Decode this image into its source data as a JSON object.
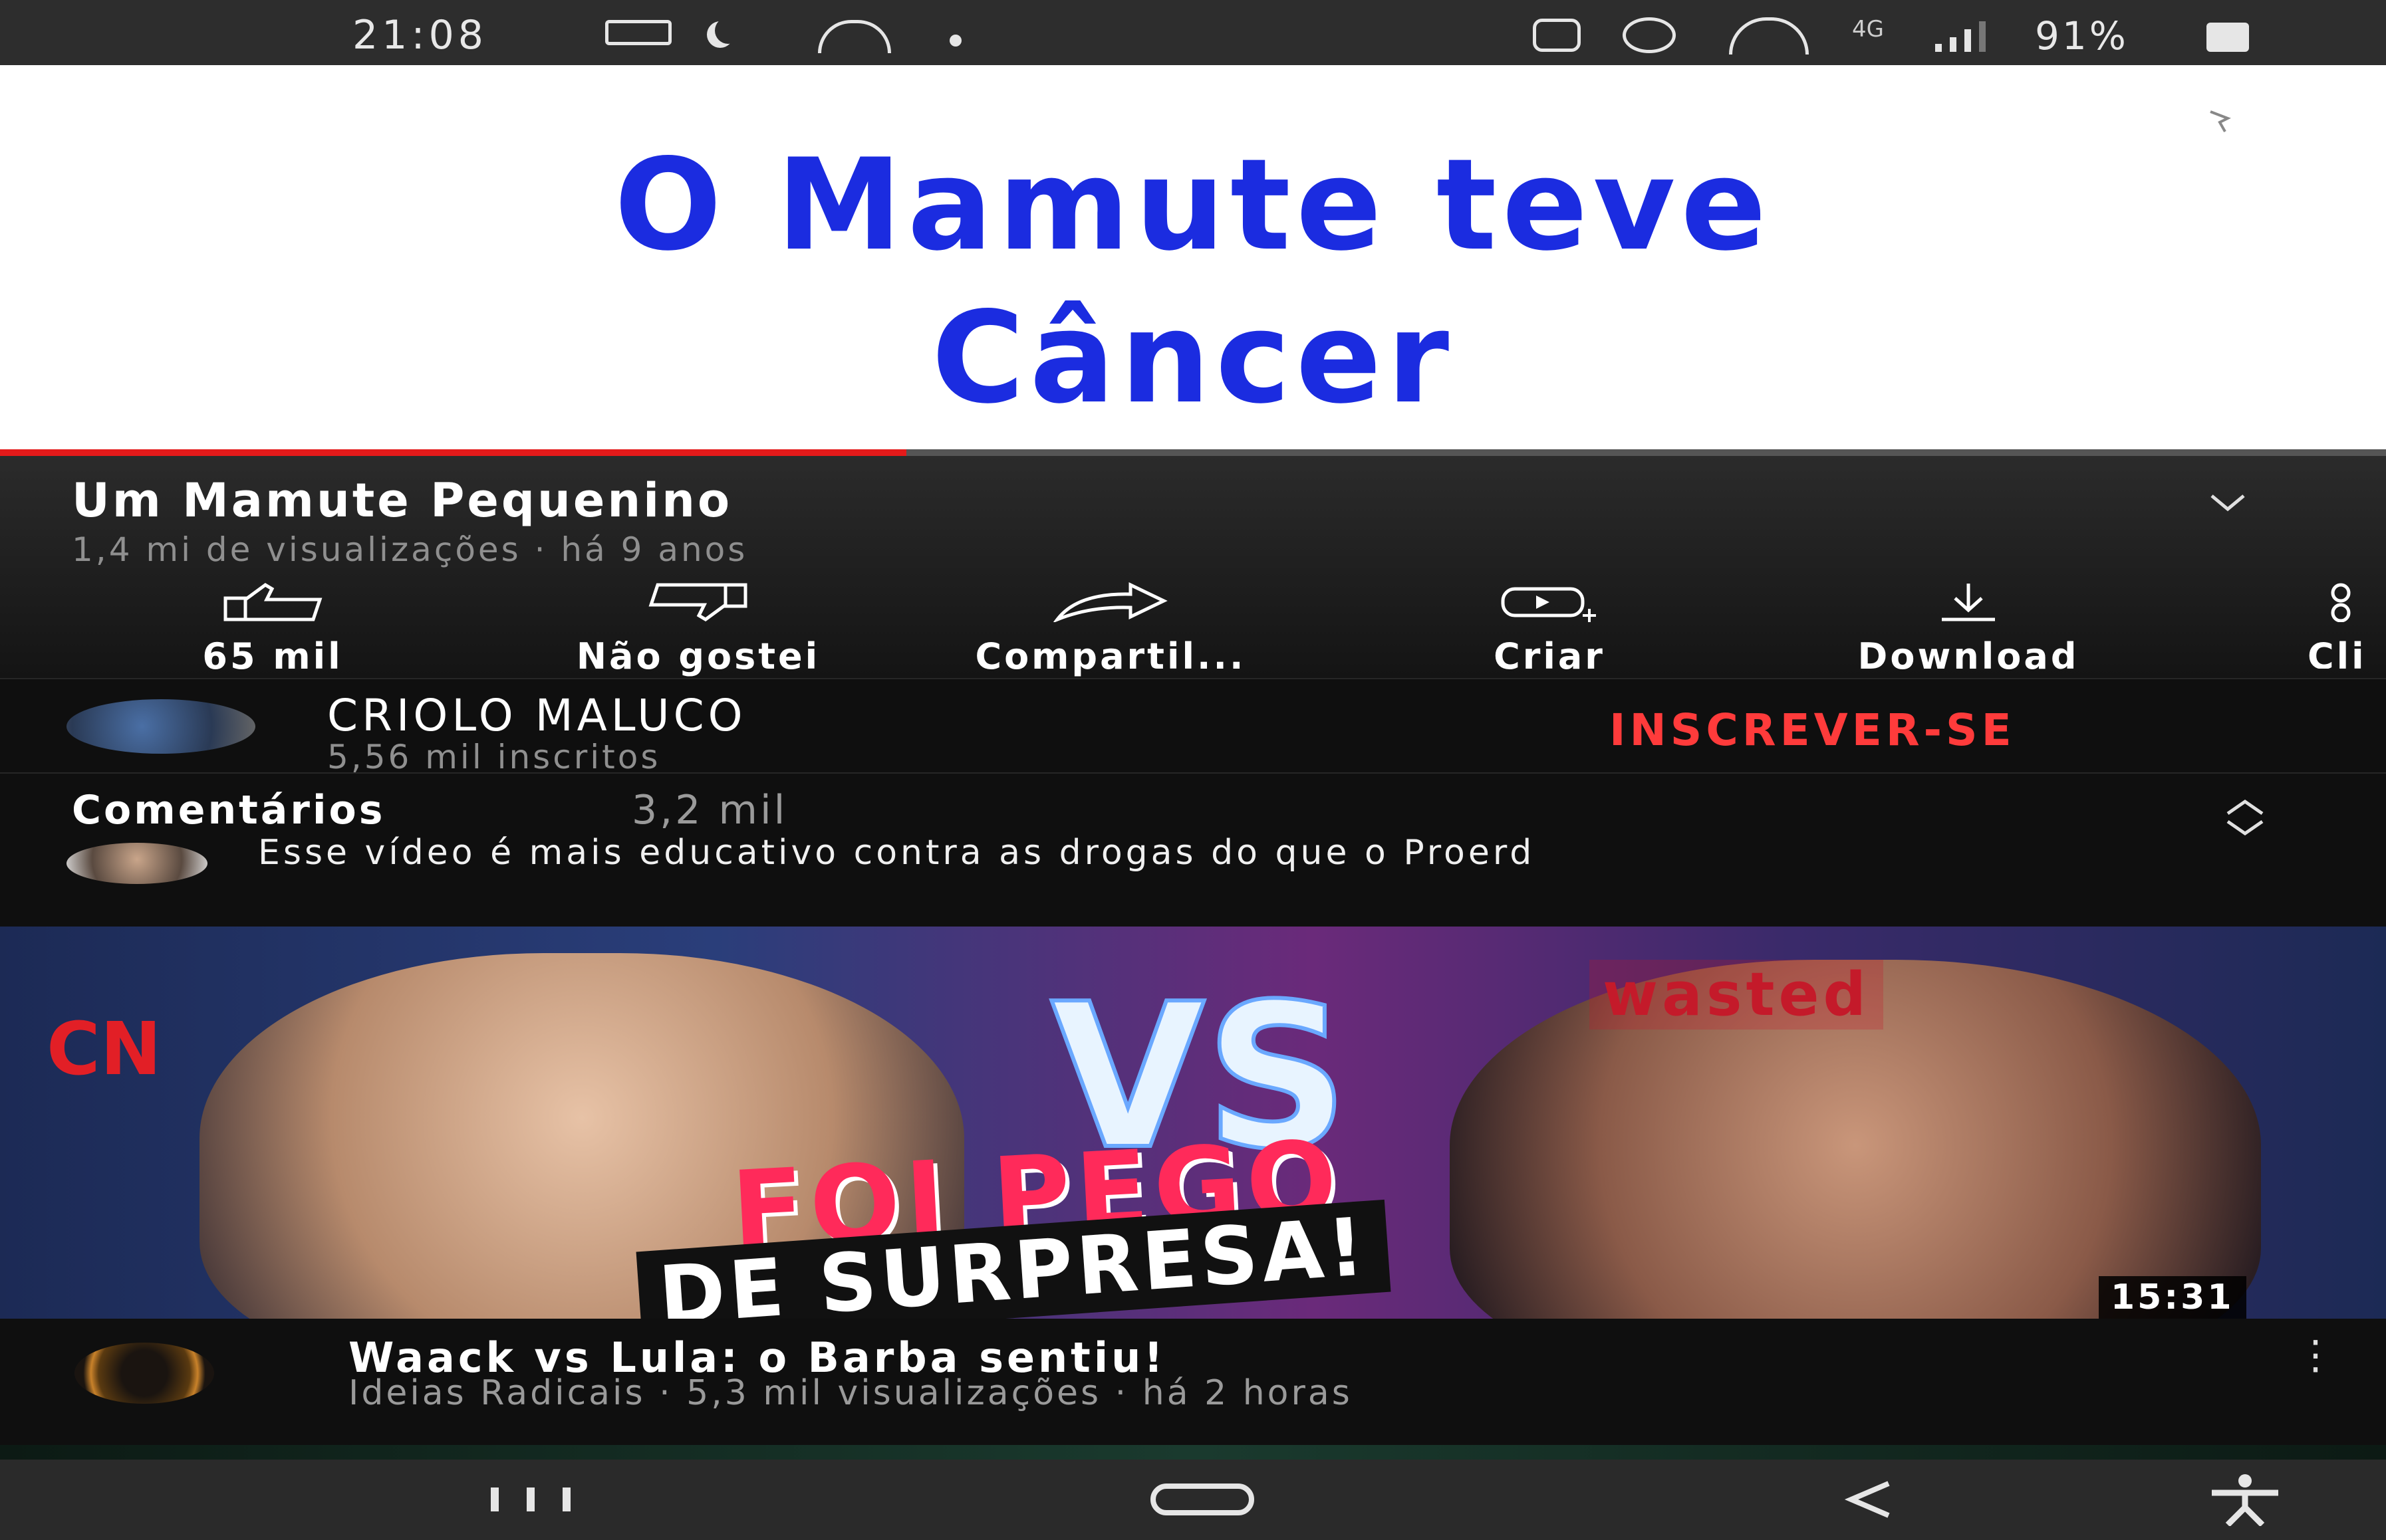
{
  "status_bar": {
    "time": "21:08",
    "network": "4G",
    "battery": "91%",
    "icons": [
      "gallery-icon",
      "moon-icon",
      "hotspot-icon",
      "dot-icon",
      "alarm-icon",
      "wifi-icon",
      "signal-icon",
      "battery-icon"
    ]
  },
  "player": {
    "overlay_line1": "O Mamute teve",
    "overlay_line2": "Câncer",
    "progress_fraction": 0.38
  },
  "video": {
    "title": "Um Mamute Pequenino",
    "meta": "1,4 mi de visualizações · há 9 anos"
  },
  "actions": [
    {
      "label": "65 mil",
      "icon": "thumbs-up-icon"
    },
    {
      "label": "Não gostei",
      "icon": "thumbs-down-icon"
    },
    {
      "label": "Compartil...",
      "icon": "share-icon"
    },
    {
      "label": "Criar",
      "icon": "create-icon"
    },
    {
      "label": "Download",
      "icon": "download-icon"
    },
    {
      "label": "Cli",
      "icon": "clip-icon"
    }
  ],
  "channel": {
    "name": "CRIOLO MALUCO",
    "subscribers": "5,56 mil inscritos",
    "subscribe_label": "INSCREVER-SE"
  },
  "comments": {
    "title": "Comentários",
    "count": "3,2 mil",
    "top_comment": "Esse vídeo é mais educativo contra as drogas do que o Proerd"
  },
  "thumbnail": {
    "text_vs": "VS",
    "text_wasted": "wasted",
    "text_cnn": "CN",
    "text_banner1": "FOI PEGO",
    "text_banner2": "DE SURPRESA!",
    "duration": "15:31"
  },
  "next_video": {
    "title": "Waack vs Lula: o Barba sentiu!",
    "meta": "Ideias Radicais · 5,3 mil visualizações · há 2 horas"
  },
  "colors": {
    "background": "#0f0f0f",
    "subscribe": "#ff3b3b",
    "progress": "#e41a1a",
    "overlay_text": "#1b2ce0"
  }
}
